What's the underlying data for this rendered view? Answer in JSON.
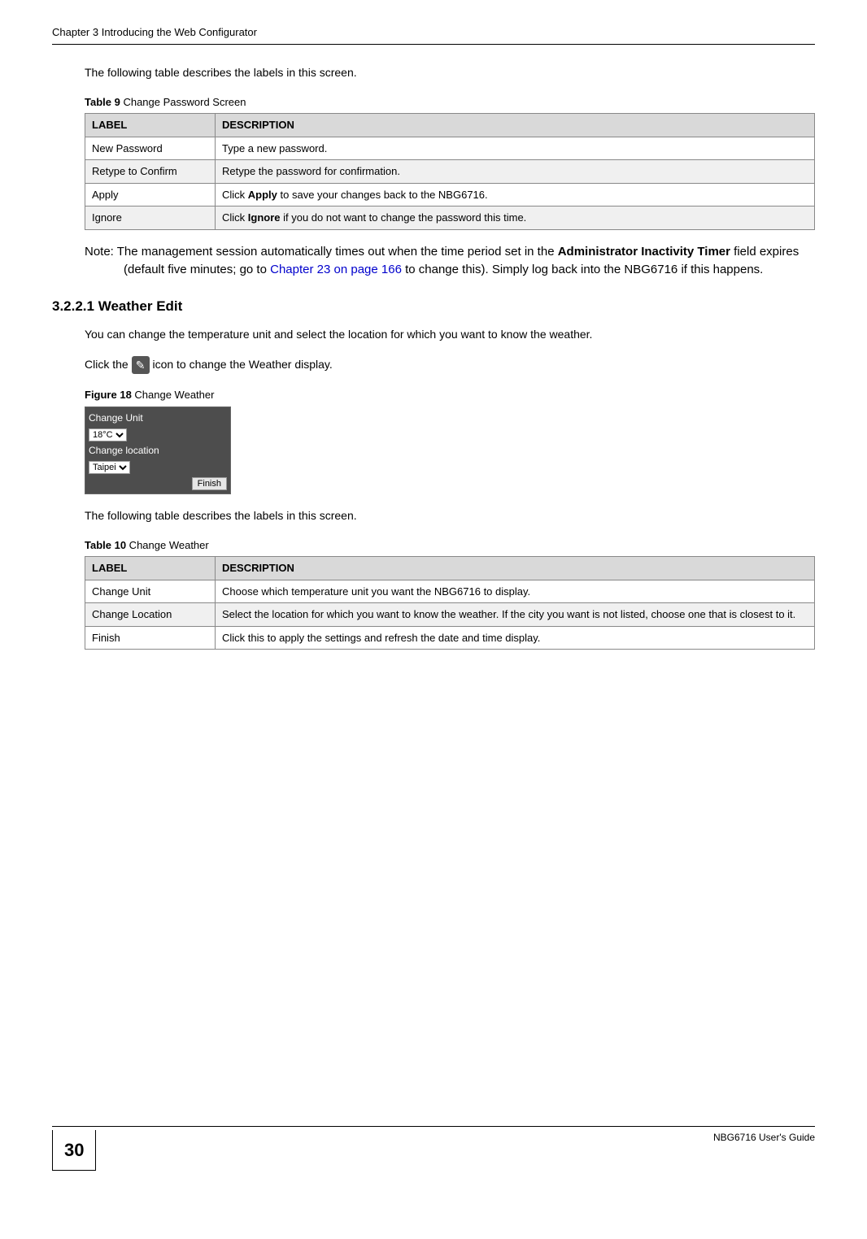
{
  "header": {
    "chapter_line": "Chapter 3 Introducing the Web Configurator"
  },
  "intro1": "The following table describes the labels in this screen.",
  "table9": {
    "caption_num": "Table 9",
    "caption_text": "   Change Password Screen",
    "head_label": "LABEL",
    "head_desc": "DESCRIPTION",
    "rows": [
      {
        "label": "New Password",
        "desc": "Type a new password."
      },
      {
        "label": "Retype to Confirm",
        "desc": "Retype the password for confirmation."
      },
      {
        "label": "Apply",
        "desc_pre": "Click ",
        "desc_b": "Apply",
        "desc_post": " to save your changes back to the NBG6716."
      },
      {
        "label": "Ignore",
        "desc_pre": "Click ",
        "desc_b": "Ignore",
        "desc_post": " if you do not want to change the password this time."
      }
    ]
  },
  "note": {
    "lead": "Note: ",
    "t1": "The management session automatically times out when the time period set in the ",
    "b1": "Administrator Inactivity Timer",
    "t2": " field expires (default five minutes; go to ",
    "xref": "Chapter 23 on page 166",
    "t3": " to change this). Simply log back into the NBG6716 if this happens."
  },
  "section": {
    "num": "3.2.2.1",
    "title": "  Weather Edit"
  },
  "para2": "You can change the temperature unit and select the location for which you want to know the weather.",
  "para3_pre": "Click the ",
  "para3_post": " icon to change the Weather display.",
  "fig18": {
    "num": "Figure 18",
    "title": "   Change Weather"
  },
  "widget": {
    "change_unit_label": "Change Unit",
    "unit_value": "18°C",
    "change_location_label": "Change location",
    "location_value": "Taipei",
    "finish_label": "Finish"
  },
  "intro2": "The following table describes the labels in this screen.",
  "table10": {
    "caption_num": "Table 10",
    "caption_text": "   Change Weather",
    "head_label": "LABEL",
    "head_desc": "DESCRIPTION",
    "rows": [
      {
        "label": "Change Unit",
        "desc": "Choose which temperature unit you want the NBG6716 to display."
      },
      {
        "label": "Change Location",
        "desc": "Select the location for which you want to know the weather. If the city you want is not listed, choose one that is closest to it."
      },
      {
        "label": "Finish",
        "desc": "Click this to apply the settings and refresh the date and time display."
      }
    ]
  },
  "footer": {
    "page": "30",
    "guide": "NBG6716 User's Guide"
  }
}
